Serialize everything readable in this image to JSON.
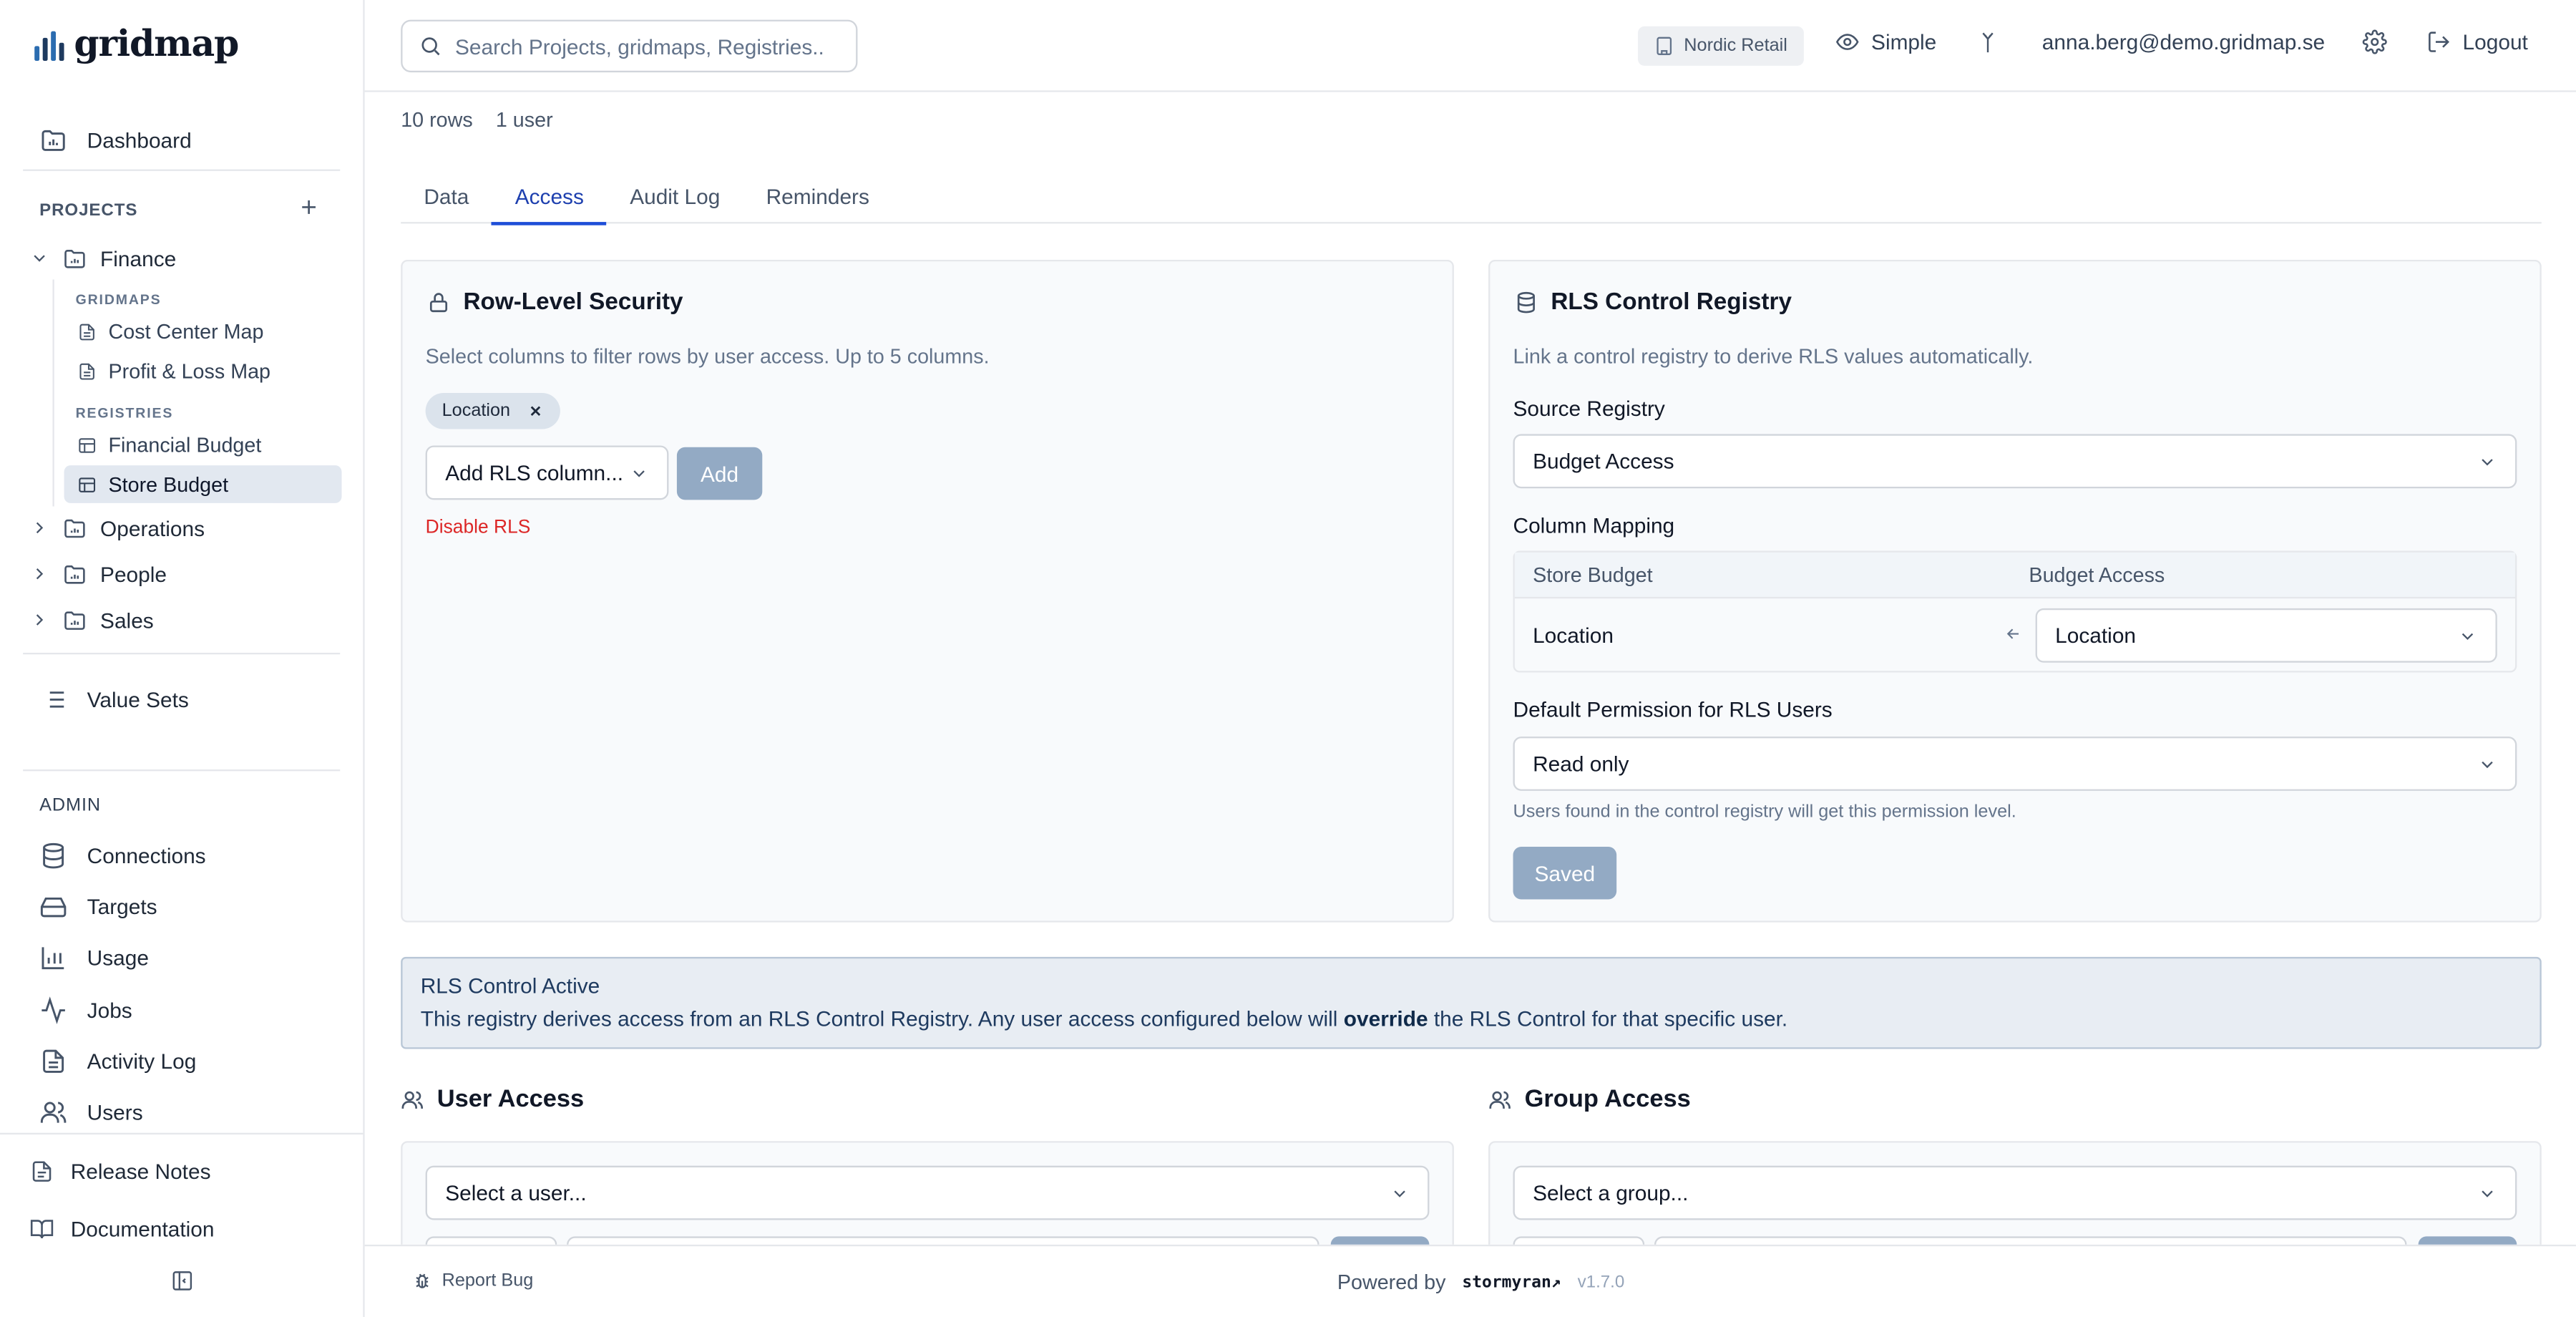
{
  "app": {
    "logo_text": "gridmap"
  },
  "sidebar": {
    "dashboard": "Dashboard",
    "projects_label": "PROJECTS",
    "projects": {
      "finance": "Finance",
      "gridmaps_label": "GRIDMAPS",
      "gridmaps": [
        "Cost Center Map",
        "Profit & Loss Map"
      ],
      "registries_label": "REGISTRIES",
      "registries": [
        "Financial Budget",
        "Store Budget"
      ],
      "operations": "Operations",
      "people": "People",
      "sales": "Sales"
    },
    "value_sets": "Value Sets",
    "admin_label": "ADMIN",
    "admin_items": [
      "Connections",
      "Targets",
      "Usage",
      "Jobs",
      "Activity Log",
      "Users"
    ],
    "release_notes": "Release Notes",
    "documentation": "Documentation"
  },
  "header": {
    "search_placeholder": "Search Projects, gridmaps, Registries..",
    "tenant": "Nordic Retail",
    "view_mode": "Simple",
    "user_email": "anna.berg@demo.gridmap.se",
    "logout": "Logout"
  },
  "main": {
    "rows": "10 rows",
    "users": "1 user",
    "tabs": [
      "Data",
      "Access",
      "Audit Log",
      "Reminders"
    ],
    "active_tab": "Access",
    "rls": {
      "title": "Row-Level Security",
      "description": "Select columns to filter rows by user access. Up to 5 columns.",
      "chip": "Location",
      "add_select": "Add RLS column...",
      "add_button": "Add",
      "disable_link": "Disable RLS"
    },
    "control": {
      "title": "RLS Control Registry",
      "description": "Link a control registry to derive RLS values automatically.",
      "source_label": "Source Registry",
      "source_value": "Budget Access",
      "mapping_label": "Column Mapping",
      "mapping_head_left": "Store Budget",
      "mapping_head_right": "Budget Access",
      "mapping_row_left": "Location",
      "mapping_row_right": "Location",
      "perm_label": "Default Permission for RLS Users",
      "perm_value": "Read only",
      "hint": "Users found in the control registry will get this permission level.",
      "saved_button": "Saved"
    },
    "banner": {
      "title": "RLS Control Active",
      "body_pre": "This registry derives access from an RLS Control Registry. Any user access configured below will ",
      "body_bold": "override",
      "body_post": " the RLS Control for that specific user."
    },
    "user_access": {
      "title": "User Access",
      "select": "Select a user..."
    },
    "group_access": {
      "title": "Group Access",
      "select": "Select a group..."
    }
  },
  "footer": {
    "report_bug": "Report Bug",
    "powered_by": "Powered by",
    "brand": "stormyran",
    "version": "v1.7.0"
  },
  "colors": {
    "accent": "#1d4ed8",
    "disabled_button": "#93aac4",
    "danger": "#dc2626",
    "banner_bg": "#e8edf3"
  }
}
